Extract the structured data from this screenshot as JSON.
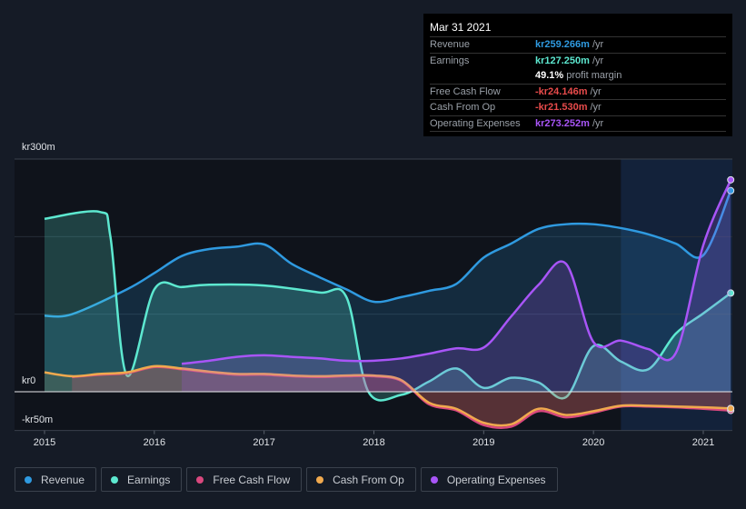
{
  "tooltip": {
    "date": "Mar 31 2021",
    "rows": [
      {
        "label": "Revenue",
        "value": "kr259.266m",
        "unit": "/yr",
        "color": "#2f9ae0"
      },
      {
        "label": "Earnings",
        "value": "kr127.250m",
        "unit": "/yr",
        "color": "#5de8d0"
      },
      {
        "label": "",
        "value": "49.1%",
        "unit": "profit margin",
        "color": "#ffffff"
      },
      {
        "label": "Free Cash Flow",
        "value": "-kr24.146m",
        "unit": "/yr",
        "color": "#e84b4b"
      },
      {
        "label": "Cash From Op",
        "value": "-kr21.530m",
        "unit": "/yr",
        "color": "#e84b4b"
      },
      {
        "label": "Operating Expenses",
        "value": "kr273.252m",
        "unit": "/yr",
        "color": "#a855f7"
      }
    ]
  },
  "chart_data": {
    "type": "area",
    "ylim": [
      -50,
      300
    ],
    "y_tick_labels": [
      {
        "value": 300,
        "label": "kr300m"
      },
      {
        "value": 0,
        "label": "kr0"
      },
      {
        "value": -50,
        "label": "-kr50m"
      }
    ],
    "x_tick_labels": [
      "2015",
      "2016",
      "2017",
      "2018",
      "2019",
      "2020",
      "2021"
    ],
    "x_range": [
      2015,
      2021.25
    ],
    "highlight_from": 2020.25,
    "grid": true,
    "legend_placement": "bottom-left",
    "series": [
      {
        "name": "Revenue",
        "color": "#2f9ae0",
        "x": [
          2015,
          2015.25,
          2015.75,
          2016,
          2016.25,
          2016.5,
          2016.75,
          2017,
          2017.25,
          2017.5,
          2017.75,
          2018,
          2018.25,
          2018.5,
          2018.75,
          2019,
          2019.25,
          2019.5,
          2019.75,
          2020,
          2020.25,
          2020.5,
          2020.75,
          2021,
          2021.25
        ],
        "y": [
          98,
          100,
          132,
          153,
          175,
          184,
          187,
          190,
          165,
          148,
          132,
          116,
          122,
          130,
          139,
          173,
          191,
          210,
          216,
          216,
          211,
          203,
          191,
          176,
          259.266
        ]
      },
      {
        "name": "Earnings",
        "color": "#5de8d0",
        "x": [
          2015,
          2015.5,
          2015.6,
          2015.75,
          2016,
          2016.25,
          2016.5,
          2017,
          2017.5,
          2017.75,
          2017.95,
          2018.25,
          2018.5,
          2018.75,
          2019,
          2019.25,
          2019.5,
          2019.75,
          2020,
          2020.25,
          2020.5,
          2020.75,
          2021,
          2021.25
        ],
        "y": [
          223,
          232,
          200,
          21,
          132,
          135,
          138,
          137,
          128,
          122,
          0,
          -4,
          13,
          30,
          5,
          18,
          12,
          -7,
          59,
          39,
          29,
          75,
          101,
          127.25
        ]
      },
      {
        "name": "Free Cash Flow",
        "color": "#d9487e",
        "x": [
          2015.25,
          2015.5,
          2015.75,
          2016,
          2016.25,
          2016.5,
          2016.75,
          2017,
          2017.25,
          2017.5,
          2017.75,
          2018,
          2018.25,
          2018.5,
          2018.75,
          2019,
          2019.25,
          2019.5,
          2019.75,
          2020,
          2020.25,
          2020.5,
          2020.75,
          2021,
          2021.25
        ],
        "y": [
          19,
          22,
          24,
          32,
          29,
          25,
          22,
          22,
          20,
          19,
          20,
          20,
          14,
          -16,
          -24,
          -43,
          -45,
          -25,
          -33,
          -27,
          -19,
          -19,
          -20,
          -22,
          -24.146
        ]
      },
      {
        "name": "Cash From Op",
        "color": "#f0a94e",
        "x": [
          2015,
          2015.25,
          2015.5,
          2015.75,
          2016,
          2016.25,
          2016.5,
          2016.75,
          2017,
          2017.25,
          2017.5,
          2017.75,
          2018,
          2018.25,
          2018.5,
          2018.75,
          2019,
          2019.25,
          2019.5,
          2019.75,
          2020,
          2020.25,
          2020.5,
          2020.75,
          2021,
          2021.25
        ],
        "y": [
          25,
          20,
          23,
          25,
          33,
          30,
          26,
          23,
          23,
          21,
          20,
          21,
          21,
          15,
          -14,
          -22,
          -40,
          -42,
          -22,
          -30,
          -25,
          -18,
          -18,
          -19,
          -20,
          -21.53
        ]
      },
      {
        "name": "Operating Expenses",
        "color": "#a855f7",
        "x": [
          2016.25,
          2016.5,
          2016.75,
          2017,
          2017.25,
          2017.5,
          2017.75,
          2018,
          2018.25,
          2018.5,
          2018.75,
          2019,
          2019.25,
          2019.5,
          2019.75,
          2020,
          2020.25,
          2020.5,
          2020.75,
          2021,
          2021.25
        ],
        "y": [
          36,
          40,
          45,
          47,
          45,
          43,
          40,
          40,
          43,
          49,
          56,
          57,
          97,
          138,
          165,
          64,
          66,
          55,
          50,
          189,
          273.252
        ]
      }
    ]
  }
}
